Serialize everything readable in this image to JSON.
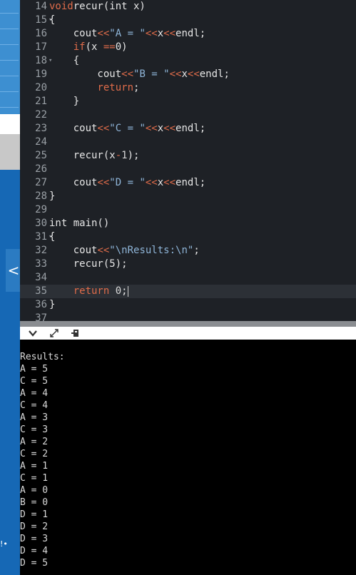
{
  "editor": {
    "lines": [
      {
        "n": "14",
        "fold": "",
        "parts": [
          [
            "kw",
            "void"
          ],
          [
            "",
            "recur(int x)"
          ]
        ]
      },
      {
        "n": "15",
        "fold": "▾",
        "parts": [
          [
            "",
            "{"
          ]
        ]
      },
      {
        "n": "16",
        "fold": "",
        "parts": [
          [
            "",
            "    cout"
          ],
          [
            "kw",
            "<<"
          ],
          [
            "str",
            "\"A = \""
          ],
          [
            "kw",
            "<<"
          ],
          [
            "",
            "x"
          ],
          [
            "kw",
            "<<"
          ],
          [
            "",
            "endl;"
          ]
        ]
      },
      {
        "n": "17",
        "fold": "",
        "parts": [
          [
            "",
            "    "
          ],
          [
            "kw",
            "if"
          ],
          [
            "",
            "(x "
          ],
          [
            "kw",
            "=="
          ],
          [
            "",
            "0)"
          ]
        ]
      },
      {
        "n": "18",
        "fold": "▾",
        "parts": [
          [
            "",
            "    {"
          ]
        ]
      },
      {
        "n": "19",
        "fold": "",
        "parts": [
          [
            "",
            "        cout"
          ],
          [
            "kw",
            "<<"
          ],
          [
            "str",
            "\"B = \""
          ],
          [
            "kw",
            "<<"
          ],
          [
            "",
            "x"
          ],
          [
            "kw",
            "<<"
          ],
          [
            "",
            "endl;"
          ]
        ]
      },
      {
        "n": "20",
        "fold": "",
        "parts": [
          [
            "",
            "        "
          ],
          [
            "kw",
            "return"
          ],
          [
            "",
            ";"
          ]
        ]
      },
      {
        "n": "21",
        "fold": "",
        "parts": [
          [
            "",
            "    }"
          ]
        ]
      },
      {
        "n": "22",
        "fold": "",
        "parts": []
      },
      {
        "n": "23",
        "fold": "",
        "parts": [
          [
            "",
            "    cout"
          ],
          [
            "kw",
            "<<"
          ],
          [
            "str",
            "\"C = \""
          ],
          [
            "kw",
            "<<"
          ],
          [
            "",
            "x"
          ],
          [
            "kw",
            "<<"
          ],
          [
            "",
            "endl;"
          ]
        ]
      },
      {
        "n": "24",
        "fold": "",
        "parts": []
      },
      {
        "n": "25",
        "fold": "",
        "parts": [
          [
            "",
            "    recur(x"
          ],
          [
            "kw",
            "-"
          ],
          [
            "num",
            "1"
          ],
          [
            "",
            ");"
          ]
        ]
      },
      {
        "n": "26",
        "fold": "",
        "parts": []
      },
      {
        "n": "27",
        "fold": "",
        "parts": [
          [
            "",
            "    cout"
          ],
          [
            "kw",
            "<<"
          ],
          [
            "str",
            "\"D = \""
          ],
          [
            "kw",
            "<<"
          ],
          [
            "",
            "x"
          ],
          [
            "kw",
            "<<"
          ],
          [
            "",
            "endl;"
          ]
        ]
      },
      {
        "n": "28",
        "fold": "",
        "parts": [
          [
            "",
            "}"
          ]
        ]
      },
      {
        "n": "29",
        "fold": "",
        "parts": []
      },
      {
        "n": "30",
        "fold": "",
        "parts": [
          [
            "",
            "int main()"
          ]
        ]
      },
      {
        "n": "31",
        "fold": "▾",
        "parts": [
          [
            "",
            "{"
          ]
        ]
      },
      {
        "n": "32",
        "fold": "",
        "parts": [
          [
            "",
            "    cout"
          ],
          [
            "kw",
            "<<"
          ],
          [
            "str",
            "\"\\nResults:\\n\""
          ],
          [
            "",
            ";"
          ]
        ]
      },
      {
        "n": "33",
        "fold": "",
        "parts": [
          [
            "",
            "    recur(5);"
          ]
        ]
      },
      {
        "n": "34",
        "fold": "",
        "parts": []
      },
      {
        "n": "35",
        "fold": "",
        "active": true,
        "parts": [
          [
            "",
            "    "
          ],
          [
            "kw",
            "return"
          ],
          [
            "num",
            " 0"
          ],
          [
            "",
            ";"
          ]
        ]
      },
      {
        "n": "36",
        "fold": "",
        "parts": [
          [
            "",
            "}"
          ]
        ]
      },
      {
        "n": "37",
        "fold": "",
        "parts": []
      }
    ]
  },
  "toolbar": {
    "icons": [
      "chevron-down-icon",
      "expand-icon",
      "debug-icon"
    ]
  },
  "output": {
    "lines": [
      "Results:",
      "A = 5",
      "C = 5",
      "A = 4",
      "C = 4",
      "A = 3",
      "C = 3",
      "A = 2",
      "C = 2",
      "A = 1",
      "C = 1",
      "A = 0",
      "B = 0",
      "D = 1",
      "D = 2",
      "D = 3",
      "D = 4",
      "D = 5"
    ]
  },
  "sidebar": {
    "toggle_glyph": "<",
    "dots": "!•"
  }
}
